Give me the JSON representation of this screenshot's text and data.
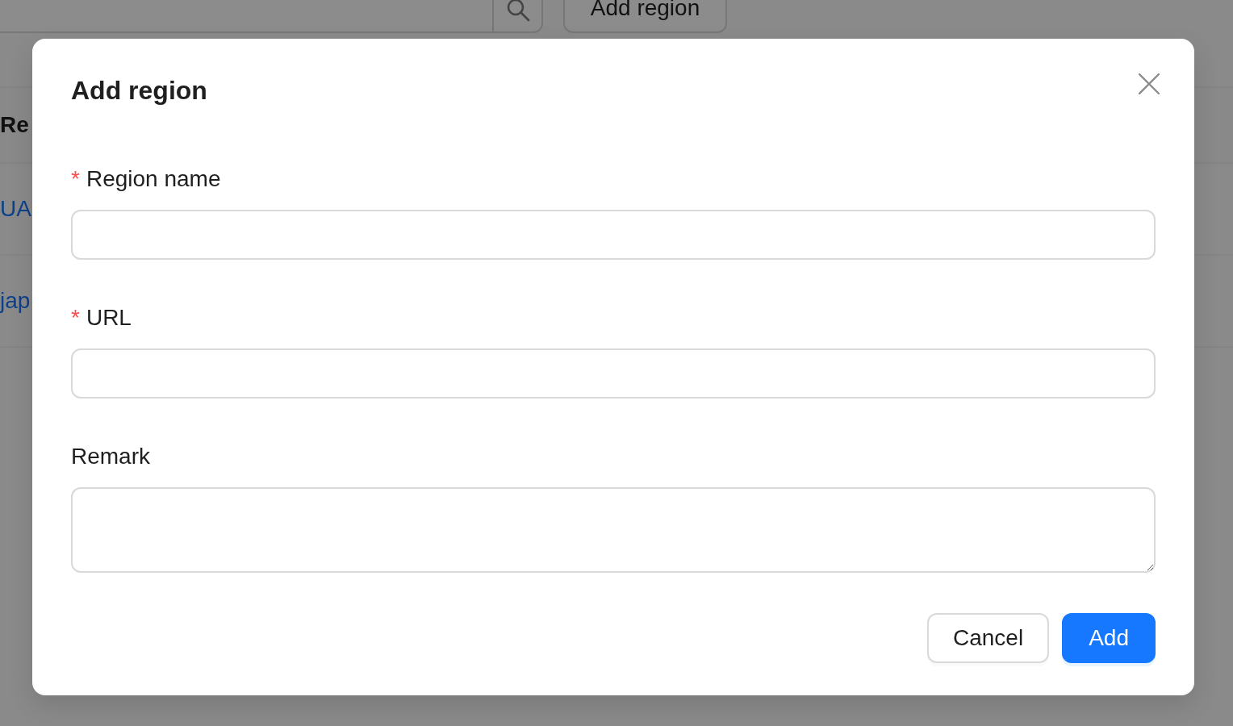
{
  "page": {
    "add_button": "Add region",
    "table": {
      "columns": [
        "Re"
      ],
      "rows": [
        [
          "UA"
        ],
        [
          "jap"
        ]
      ]
    }
  },
  "dialog": {
    "title": "Add region",
    "fields": [
      {
        "kind": "input",
        "label": "Region name",
        "required_mark": "*"
      },
      {
        "kind": "input",
        "label": "URL",
        "required_mark": "*"
      },
      {
        "kind": "textarea",
        "label": "Remark"
      }
    ],
    "buttons": [
      {
        "kind": "default",
        "label": "Cancel"
      },
      {
        "kind": "primary",
        "label": "Add"
      }
    ]
  }
}
